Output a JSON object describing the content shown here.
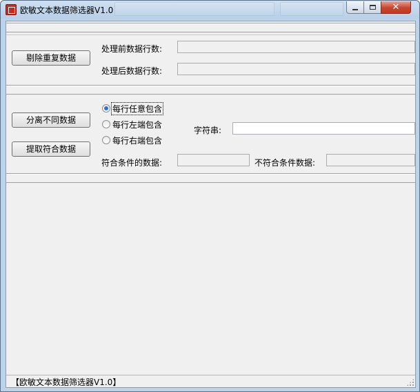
{
  "window": {
    "title": "欧敏文本数据筛选器V1.0",
    "icon": "app-logo-icon",
    "controls": {
      "minimize_icon": "minimize-icon",
      "maximize_icon": "maximize-icon",
      "close_icon": "close-icon",
      "close_glyph": "✕"
    }
  },
  "section_dedupe": {
    "button_label": "剔除重复数据",
    "before_label": "处理前数据行数:",
    "before_value": "",
    "after_label": "处理后数据行数:",
    "after_value": ""
  },
  "section_filter": {
    "split_button_label": "分离不同数据",
    "extract_button_label": "提取符合数据",
    "radios": [
      {
        "label": "每行任意包含",
        "checked": true
      },
      {
        "label": "每行左端包含",
        "checked": false
      },
      {
        "label": "每行右端包含",
        "checked": false
      }
    ],
    "string_label": "字符串:",
    "string_value": "",
    "match_label": "符合条件的数据:",
    "match_value": "",
    "nomatch_label": "不符合条件数据:",
    "nomatch_value": ""
  },
  "statusbar": {
    "text": "【欧敏文本数据筛选器V1.0】"
  },
  "colors": {
    "accent": "#2b73d8",
    "close_button": "#c8442e",
    "titlebar": "#b8cfe7"
  }
}
